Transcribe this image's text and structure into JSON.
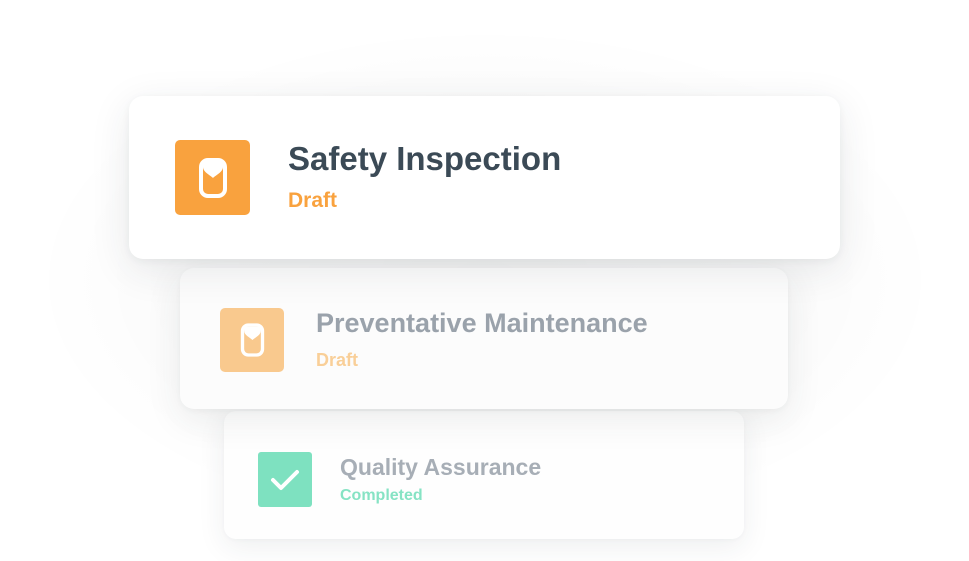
{
  "colors": {
    "draft_accent": "#f9a23e",
    "completed_accent": "#7ee1c0",
    "title_text": "#3b4a56"
  },
  "cards": [
    {
      "title": "Safety Inspection",
      "status": "Draft",
      "icon": "hourglass-icon"
    },
    {
      "title": "Preventative Maintenance",
      "status": "Draft",
      "icon": "hourglass-icon"
    },
    {
      "title": "Quality Assurance",
      "status": "Completed",
      "icon": "checkmark-icon"
    }
  ]
}
